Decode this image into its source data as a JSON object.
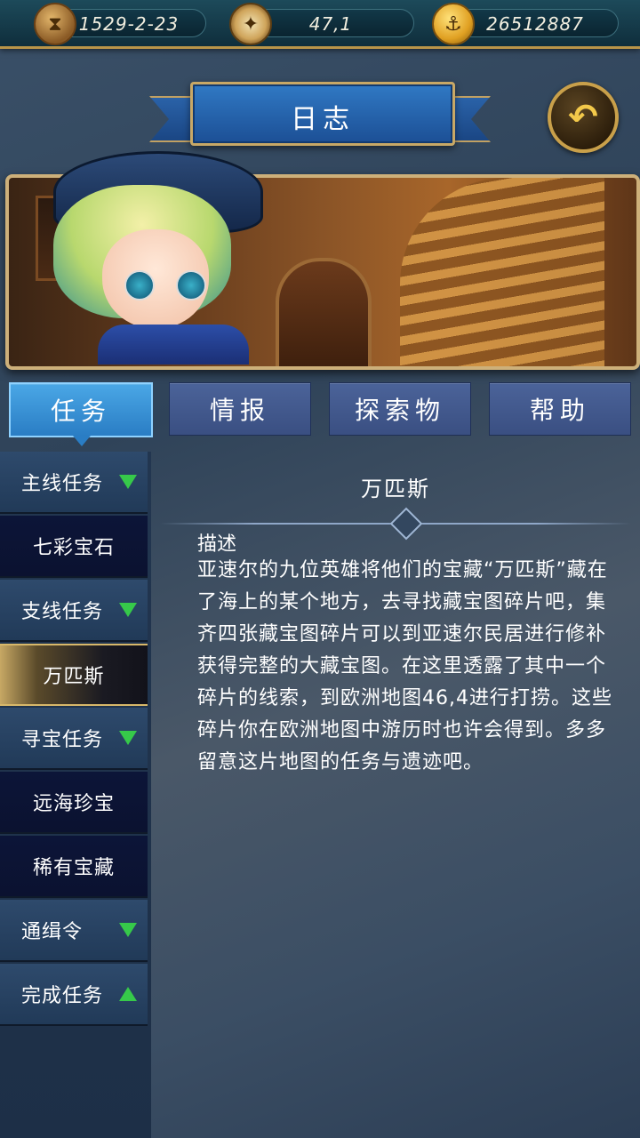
{
  "topbar": {
    "date": "1529-2-23",
    "coordinates": "47,1",
    "gold": "26512887",
    "icons": [
      "hourglass-icon",
      "compass-icon",
      "anchor-coin-icon"
    ]
  },
  "header": {
    "title": "日志"
  },
  "tabs": [
    {
      "label": "任务",
      "active": true
    },
    {
      "label": "情报",
      "active": false
    },
    {
      "label": "探索物",
      "active": false
    },
    {
      "label": "帮助",
      "active": false
    }
  ],
  "sidebar": {
    "items": [
      {
        "label": "主线任务",
        "type": "category",
        "expanded": true
      },
      {
        "label": "七彩宝石",
        "type": "entry"
      },
      {
        "label": "支线任务",
        "type": "category",
        "expanded": true
      },
      {
        "label": "万匹斯",
        "type": "entry",
        "selected": true
      },
      {
        "label": "寻宝任务",
        "type": "category",
        "expanded": true
      },
      {
        "label": "远海珍宝",
        "type": "entry"
      },
      {
        "label": "稀有宝藏",
        "type": "entry"
      },
      {
        "label": "通缉令",
        "type": "category",
        "expanded": true
      },
      {
        "label": "完成任务",
        "type": "category",
        "expanded": false
      }
    ]
  },
  "detail": {
    "title": "万匹斯",
    "description_label": "描述",
    "description": "亚速尔的九位英雄将他们的宝藏“万匹斯”藏在了海上的某个地方，去寻找藏宝图碎片吧，集齐四张藏宝图碎片可以到亚速尔民居进行修补获得完整的大藏宝图。在这里透露了其中一个碎片的线索，到欧洲地图46,4进行打捞。这些碎片你在欧洲地图中游历时也许会得到。多多留意这片地图的任务与遗迹吧。"
  },
  "colors": {
    "accent_gold": "#c9a04a",
    "tab_active": "#2a7dc4",
    "tab_inactive": "#3a4f82",
    "expand_arrow": "#36c94a"
  }
}
